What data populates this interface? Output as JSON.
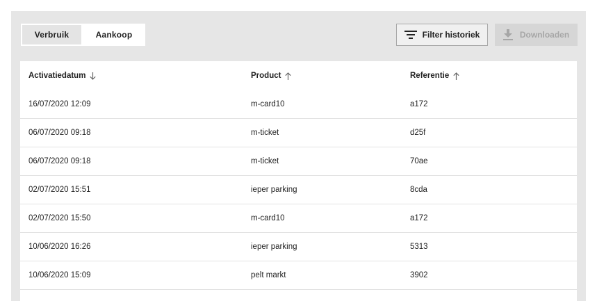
{
  "tabs": [
    {
      "label": "Verbruik",
      "active": true
    },
    {
      "label": "Aankoop",
      "active": false
    }
  ],
  "toolbar": {
    "filter_label": "Filter historiek",
    "download_label": "Downloaden",
    "filter_icon": "filter-lines-icon",
    "download_icon": "download-icon"
  },
  "table": {
    "columns": [
      {
        "label": "Activatiedatum",
        "sort": "desc"
      },
      {
        "label": "Product",
        "sort": "asc"
      },
      {
        "label": "Referentie",
        "sort": "asc"
      }
    ],
    "rows": [
      {
        "date": "16/07/2020 12:09",
        "product": "m-card10",
        "ref": "a172"
      },
      {
        "date": "06/07/2020 09:18",
        "product": "m-ticket",
        "ref": "d25f"
      },
      {
        "date": "06/07/2020 09:18",
        "product": "m-ticket",
        "ref": "70ae"
      },
      {
        "date": "02/07/2020 15:51",
        "product": "ieper parking",
        "ref": "8cda"
      },
      {
        "date": "02/07/2020 15:50",
        "product": "m-card10",
        "ref": "a172"
      },
      {
        "date": "10/06/2020 16:26",
        "product": "ieper parking",
        "ref": "5313"
      },
      {
        "date": "10/06/2020 15:09",
        "product": "pelt markt",
        "ref": "3902"
      }
    ]
  },
  "colors": {
    "panel_bg": "#e6e6e6",
    "active_tab_bg": "#e4e4e4",
    "disabled_text": "#a6a6a6",
    "disabled_bg": "#d6d6d6"
  }
}
